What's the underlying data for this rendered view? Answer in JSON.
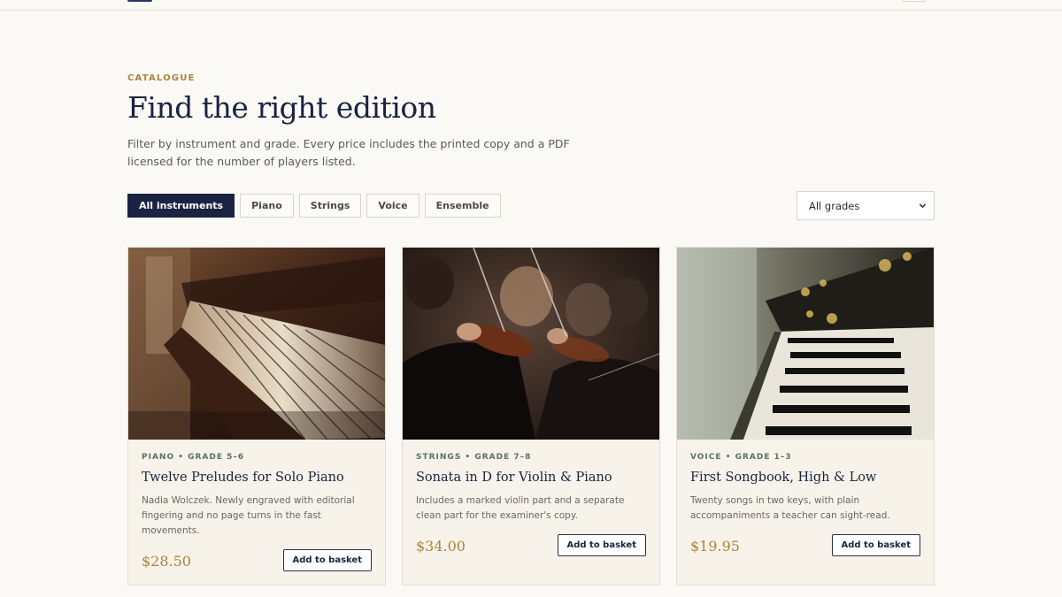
{
  "header": {
    "eyebrow": "CATALOGUE",
    "title": "Find the right edition",
    "intro": "Filter by instrument and grade. Every price includes the printed copy and a PDF licensed for the number of players listed."
  },
  "filters": {
    "chips": [
      "All instruments",
      "Piano",
      "Strings",
      "Voice",
      "Ensemble"
    ],
    "active": "All instruments",
    "grade_select": {
      "value": "All grades"
    }
  },
  "cards": [
    {
      "meta": "PIANO • GRADE 5–6",
      "title": "Twelve Preludes for Solo Piano",
      "description": "Nadia Wolczek. Newly engraved with editorial fingering and no page turns in the fast movements.",
      "price": "$28.50",
      "button": "Add to basket",
      "image": "grand-piano-keys-photo"
    },
    {
      "meta": "STRINGS • GRADE 7–8",
      "title": "Sonata in D for Violin & Piano",
      "description": "Includes a marked violin part and a separate clean part for the examiner's copy.",
      "price": "$34.00",
      "button": "Add to basket",
      "image": "orchestra-violinists-photo"
    },
    {
      "meta": "VOICE • GRADE 1–3",
      "title": "First Songbook, High & Low",
      "description": "Twenty songs in two keys, with plain accompaniments a teacher can sight-read.",
      "price": "$19.95",
      "button": "Add to basket",
      "image": "piano-keys-bokeh-photo"
    }
  ],
  "colors": {
    "accent": "#a8853a",
    "navy": "#1b2342",
    "background": "#fbf9f6",
    "card": "#f7f3ea"
  }
}
